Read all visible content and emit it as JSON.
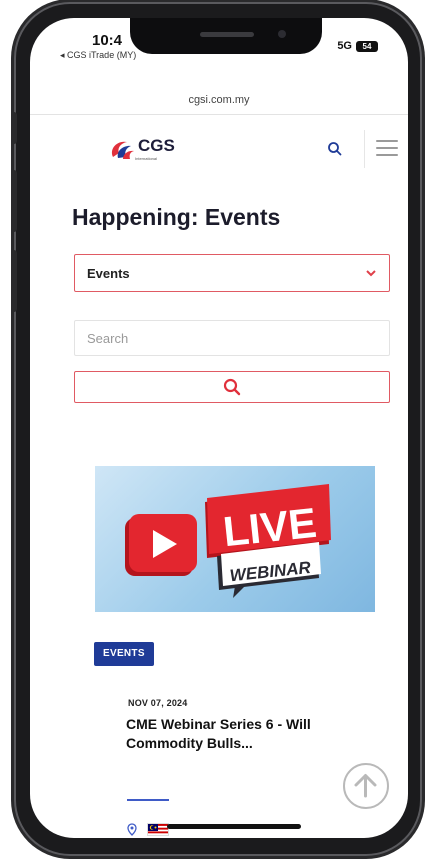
{
  "status": {
    "time": "10:4",
    "back_app": "◂ CGS iTrade (MY)",
    "network": "5G",
    "battery": "54"
  },
  "browser": {
    "url": "cgsi.com.my"
  },
  "header": {
    "logo_text": "CGS",
    "logo_sub": "International",
    "search_icon": "search-icon",
    "menu_icon": "hamburger-menu-icon",
    "accent": "#1f3b97",
    "brand_red": "#e0303c"
  },
  "page": {
    "title": "Happening: Events",
    "filter": {
      "selected": "Events"
    },
    "search": {
      "placeholder": "Search"
    }
  },
  "event": {
    "banner": {
      "word_live": "LIVE",
      "word_webinar": "WEBINAR"
    },
    "category": "EVENTS",
    "date": "NOV 07, 2024",
    "title": "CME Webinar Series 6 - Will Commodity Bulls..."
  },
  "scroll_top_icon": "arrow-up-circle-icon"
}
